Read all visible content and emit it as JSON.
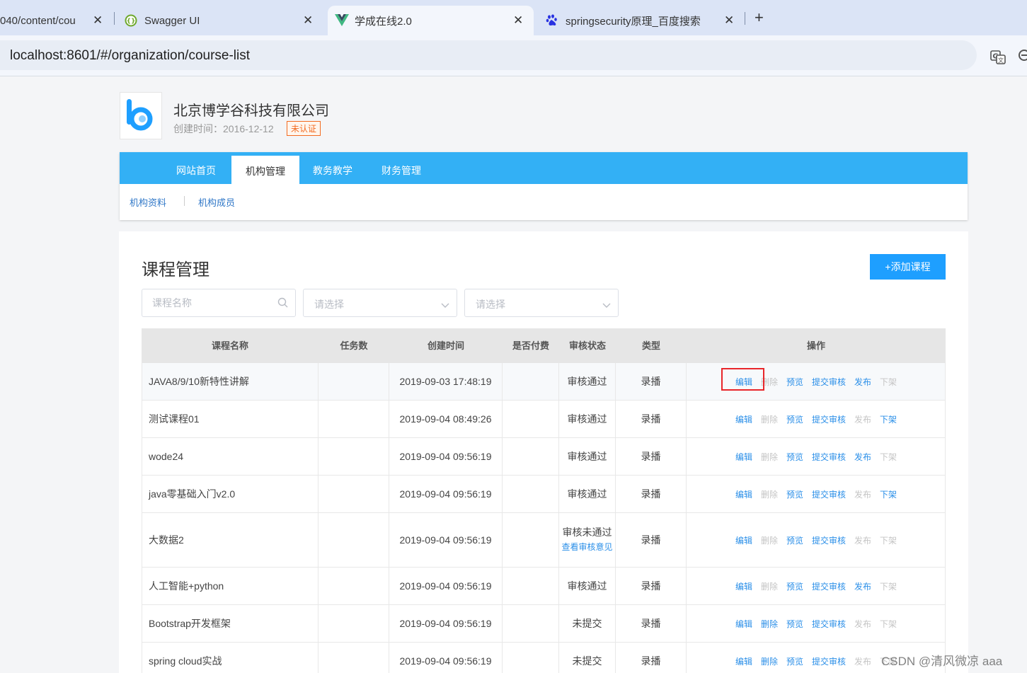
{
  "browser": {
    "tabs": [
      {
        "title": "040/content/cou",
        "active": false
      },
      {
        "title": "Swagger UI",
        "active": false
      },
      {
        "title": "学成在线2.0",
        "active": true
      },
      {
        "title": "springsecurity原理_百度搜索",
        "active": false
      }
    ],
    "new_tab_label": "+",
    "close_label": "✕",
    "url": "localhost:8601/#/organization/course-list"
  },
  "org": {
    "name": "北京博学谷科技有限公司",
    "created": "创建时间：2016-12-12",
    "badge": "未认证"
  },
  "nav": {
    "items": [
      "网站首页",
      "机构管理",
      "教务教学",
      "财务管理"
    ],
    "active_index": 1,
    "sub_items": [
      "机构资料",
      "机构成员"
    ]
  },
  "page": {
    "title": "课程管理",
    "add_button": "+添加课程",
    "search_placeholder": "课程名称",
    "select1_placeholder": "请选择",
    "select2_placeholder": "请选择"
  },
  "table": {
    "columns": [
      "课程名称",
      "任务数",
      "创建时间",
      "是否付费",
      "审核状态",
      "类型",
      "操作"
    ],
    "op_labels": [
      "编辑",
      "删除",
      "预览",
      "提交审核",
      "发布",
      "下架"
    ],
    "rows": [
      {
        "name": "JAVA8/9/10新特性讲解",
        "tasks": "",
        "created": "2019-09-03 17:48:19",
        "paid": "",
        "status": "审核通过",
        "status_link": "",
        "type": "录播",
        "ops_enabled": [
          true,
          false,
          true,
          true,
          true,
          false
        ]
      },
      {
        "name": "测试课程01",
        "tasks": "",
        "created": "2019-09-04 08:49:26",
        "paid": "",
        "status": "审核通过",
        "status_link": "",
        "type": "录播",
        "ops_enabled": [
          true,
          false,
          true,
          true,
          false,
          true
        ]
      },
      {
        "name": "wode24",
        "tasks": "",
        "created": "2019-09-04 09:56:19",
        "paid": "",
        "status": "审核通过",
        "status_link": "",
        "type": "录播",
        "ops_enabled": [
          true,
          false,
          true,
          true,
          true,
          false
        ]
      },
      {
        "name": "java零基础入门v2.0",
        "tasks": "",
        "created": "2019-09-04 09:56:19",
        "paid": "",
        "status": "审核通过",
        "status_link": "",
        "type": "录播",
        "ops_enabled": [
          true,
          false,
          true,
          true,
          false,
          true
        ]
      },
      {
        "name": "大数据2",
        "tasks": "",
        "created": "2019-09-04 09:56:19",
        "paid": "",
        "status": "审核未通过",
        "status_link": "查看审核意见",
        "type": "录播",
        "ops_enabled": [
          true,
          false,
          true,
          true,
          false,
          false
        ]
      },
      {
        "name": "人工智能+python",
        "tasks": "",
        "created": "2019-09-04 09:56:19",
        "paid": "",
        "status": "审核通过",
        "status_link": "",
        "type": "录播",
        "ops_enabled": [
          true,
          false,
          true,
          true,
          true,
          false
        ]
      },
      {
        "name": "Bootstrap开发框架",
        "tasks": "",
        "created": "2019-09-04 09:56:19",
        "paid": "",
        "status": "未提交",
        "status_link": "",
        "type": "录播",
        "ops_enabled": [
          true,
          true,
          true,
          true,
          false,
          false
        ]
      },
      {
        "name": "spring cloud实战",
        "tasks": "",
        "created": "2019-09-04 09:56:19",
        "paid": "",
        "status": "未提交",
        "status_link": "",
        "type": "录播",
        "ops_enabled": [
          true,
          true,
          true,
          true,
          false,
          false
        ]
      }
    ]
  },
  "watermark": "CSDN @清风微凉 aaa",
  "colors": {
    "nav_blue": "#33b0f5",
    "button_blue": "#1e9fff",
    "link_blue": "#2b8fe8",
    "disabled_gray": "#c4c4c4",
    "badge_orange": "#f36b21",
    "highlight_red": "#e8262a"
  }
}
